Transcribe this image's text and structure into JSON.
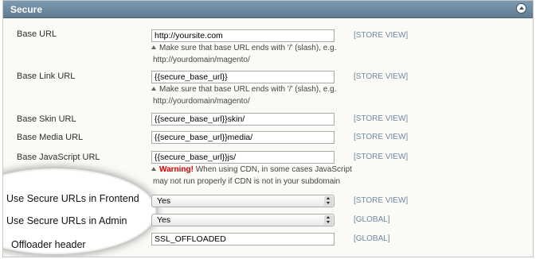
{
  "section": {
    "title": "Secure"
  },
  "fields": {
    "base_url": {
      "label": "Base URL",
      "value": "http://yoursite.com",
      "scope": "[STORE VIEW]",
      "note_line1": "Make sure that base URL ends with '/' (slash), e.g.",
      "note_line2": "http://yourdomain/magento/"
    },
    "base_link_url": {
      "label": "Base Link URL",
      "value": "{{secure_base_url}}",
      "scope": "[STORE VIEW]",
      "note_line1": "Make sure that base URL ends with '/' (slash), e.g.",
      "note_line2": "http://yourdomain/magento/"
    },
    "base_skin_url": {
      "label": "Base Skin URL",
      "value": "{{secure_base_url}}skin/",
      "scope": "[STORE VIEW]"
    },
    "base_media_url": {
      "label": "Base Media URL",
      "value": "{{secure_base_url}}media/",
      "scope": "[STORE VIEW]"
    },
    "base_js_url": {
      "label": "Base JavaScript URL",
      "value": "{{secure_base_url}}js/",
      "scope": "[STORE VIEW]",
      "warning_label": "Warning!",
      "warning_line1": " When using CDN, in some cases JavaScript",
      "warning_line2": "may not run properly if CDN is not in your subdomain"
    },
    "use_secure_frontend": {
      "label": "Use Secure URLs in Frontend",
      "value": "Yes",
      "scope": "[STORE VIEW]"
    },
    "use_secure_admin": {
      "label": "Use Secure URLs in Admin",
      "value": "Yes",
      "scope": "[GLOBAL]"
    },
    "offloader_header": {
      "label": "Offloader header",
      "value": "SSL_OFFLOADED",
      "scope": "[GLOBAL]"
    }
  }
}
